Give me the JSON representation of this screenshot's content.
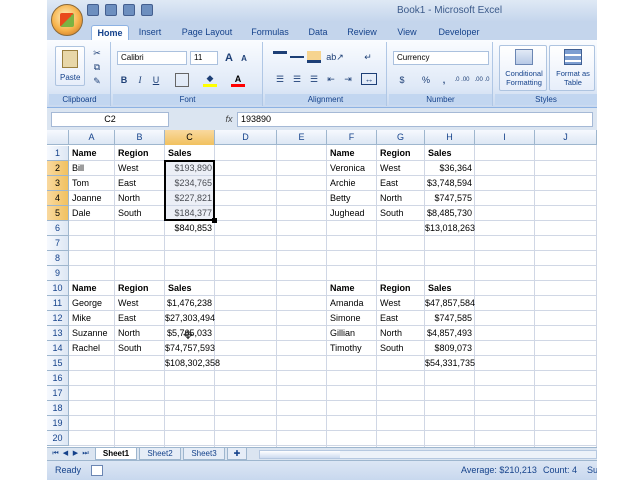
{
  "window": {
    "title": "Book1 - Microsoft Excel"
  },
  "tabs": [
    "Home",
    "Insert",
    "Page Layout",
    "Formulas",
    "Data",
    "Review",
    "View",
    "Developer"
  ],
  "ribbon": {
    "clipboard": {
      "label": "Clipboard",
      "paste": "Paste"
    },
    "font": {
      "label": "Font",
      "name": "Calibri",
      "size": "11",
      "bold": "B",
      "italic": "I",
      "underline": "U",
      "grow": "A",
      "shrink": "A"
    },
    "alignment": {
      "label": "Alignment"
    },
    "number": {
      "label": "Number",
      "format": "Currency",
      "currency": "$",
      "percent": "%",
      "comma": ",",
      "inc_dec": ".0 .00",
      "dec_dec": ".00 .0"
    },
    "styles": {
      "label": "Styles",
      "cond": "Conditional Formatting",
      "table": "Format as Table"
    }
  },
  "formula_bar": {
    "name_box": "C2",
    "fx": "fx",
    "value": "193890"
  },
  "columns": [
    "A",
    "B",
    "C",
    "D",
    "E",
    "F",
    "G",
    "H",
    "I",
    "J"
  ],
  "rows": [
    "1",
    "2",
    "3",
    "4",
    "5",
    "6",
    "7",
    "8",
    "9",
    "10",
    "11",
    "12",
    "13",
    "14",
    "15",
    "16",
    "17",
    "18",
    "19",
    "20"
  ],
  "cells": {
    "A1": "Name",
    "B1": "Region",
    "C1": "Sales",
    "A2": "Bill",
    "B2": "West",
    "C2": "$193,890",
    "A3": "Tom",
    "B3": "East",
    "C3": "$234,765",
    "A4": "Joanne",
    "B4": "North",
    "C4": "$227,821",
    "A5": "Dale",
    "B5": "South",
    "C5": "$184,377",
    "C6": "$840,853",
    "F1": "Name",
    "G1": "Region",
    "H1": "Sales",
    "F2": "Veronica",
    "G2": "West",
    "H2": "$36,364",
    "F3": "Archie",
    "G3": "East",
    "H3": "$3,748,594",
    "F4": "Betty",
    "G4": "North",
    "H4": "$747,575",
    "F5": "Jughead",
    "G5": "South",
    "H5": "$8,485,730",
    "H6": "$13,018,263",
    "A10": "Name",
    "B10": "Region",
    "C10": "Sales",
    "A11": "George",
    "B11": "West",
    "C11": "$1,476,238",
    "A12": "Mike",
    "B12": "East",
    "C12": "$27,303,494",
    "A13": "Suzanne",
    "B13": "North",
    "C13": "$5,765,033",
    "A14": "Rachel",
    "B14": "South",
    "C14": "$74,757,593",
    "C15": "$108,302,358",
    "F10": "Name",
    "G10": "Region",
    "H10": "Sales",
    "F11": "Amanda",
    "G11": "West",
    "H11": "$47,857,584",
    "F12": "Simone",
    "G12": "East",
    "H12": "$747,585",
    "F13": "Gillian",
    "G13": "North",
    "H13": "$4,857,493",
    "F14": "Timothy",
    "G14": "South",
    "H14": "$809,073",
    "H15": "$54,331,735"
  },
  "sheets": [
    "Sheet1",
    "Sheet2",
    "Sheet3"
  ],
  "active_sheet": "Sheet1",
  "selection": {
    "active_cell": "C2",
    "range": "C2:C5"
  },
  "status": {
    "ready": "Ready",
    "average": "Average: $210,213",
    "count": "Count: 4",
    "sum": "Su"
  },
  "colors": {
    "accent": "#15428b",
    "ribbon": "#dbe5f1",
    "selected_header": "#f1c15f"
  }
}
